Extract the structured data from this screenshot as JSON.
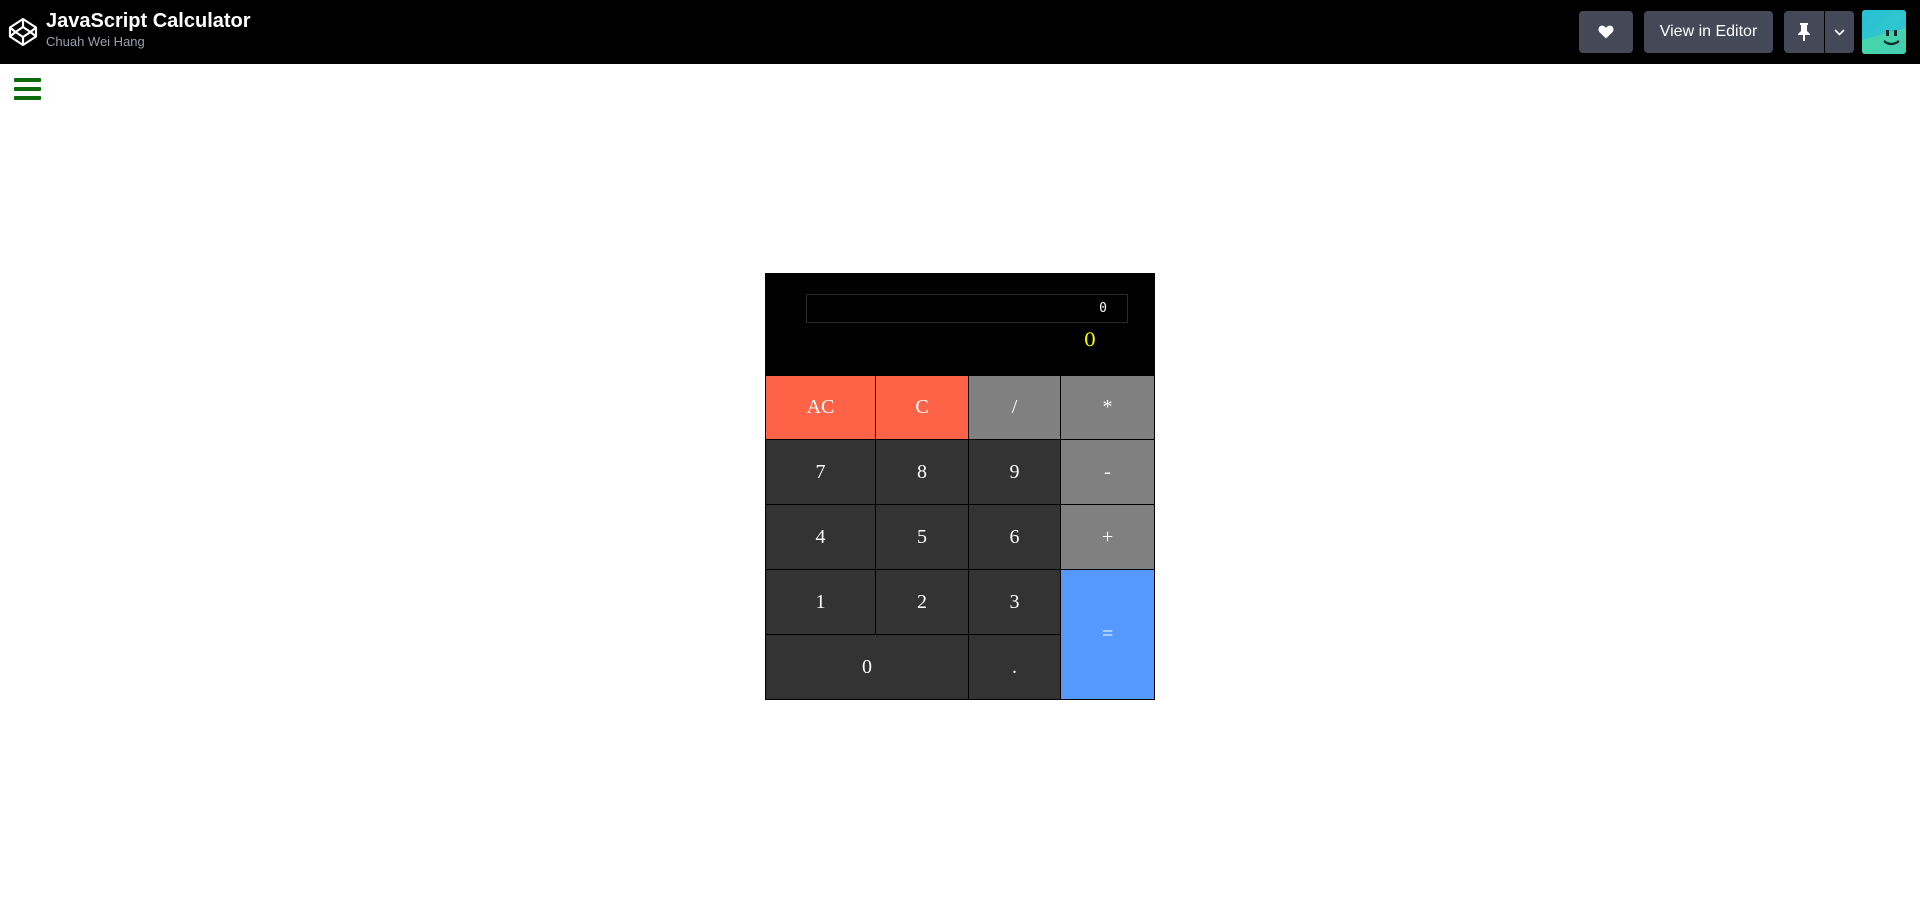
{
  "header": {
    "title": "JavaScript Calculator",
    "author": "Chuah Wei Hang",
    "view_in_editor_label": "View in Editor"
  },
  "icons": {
    "logo": "codepen-logo-icon",
    "heart": "heart-icon",
    "pin": "pin-icon",
    "dropdown": "chevron-down-icon",
    "menu": "hamburger-menu-icon",
    "avatar": "user-avatar"
  },
  "colors": {
    "header_bg": "#000000",
    "clear_keys": "#ff6347",
    "operator_keys": "#808080",
    "number_keys": "#333333",
    "equals_key": "#5599ff",
    "output_text": "#ffff00",
    "menu_icon": "#0b6b0b"
  },
  "calculator": {
    "formula": "0",
    "output": "0",
    "keys": {
      "ac": "AC",
      "c": "C",
      "divide": "/",
      "multiply": "*",
      "seven": "7",
      "eight": "8",
      "nine": "9",
      "subtract": "-",
      "four": "4",
      "five": "5",
      "six": "6",
      "add": "+",
      "one": "1",
      "two": "2",
      "three": "3",
      "equals": "=",
      "zero": "0",
      "decimal": "."
    }
  }
}
